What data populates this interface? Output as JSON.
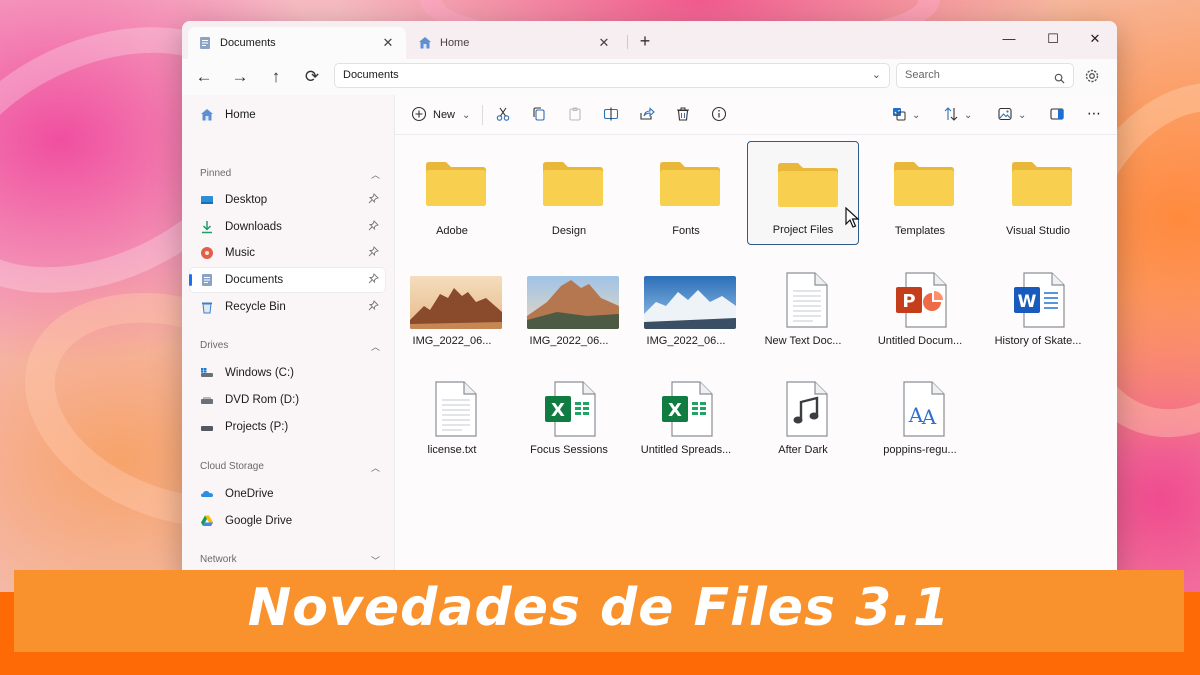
{
  "tabs": [
    {
      "label": "Documents",
      "icon": "documents-icon",
      "active": true
    },
    {
      "label": "Home",
      "icon": "home-icon",
      "active": false
    }
  ],
  "address": {
    "path": "Documents",
    "search_placeholder": "Search"
  },
  "sidebar": {
    "home": "Home",
    "sections": {
      "pinned": "Pinned",
      "drives": "Drives",
      "cloud": "Cloud Storage",
      "network": "Network"
    },
    "pinned": [
      {
        "label": "Desktop",
        "icon": "desktop-icon"
      },
      {
        "label": "Downloads",
        "icon": "download-icon"
      },
      {
        "label": "Music",
        "icon": "music-icon"
      },
      {
        "label": "Documents",
        "icon": "documents-icon",
        "selected": true
      },
      {
        "label": "Recycle Bin",
        "icon": "recycle-bin-icon"
      }
    ],
    "drives": [
      {
        "label": "Windows (C:)",
        "icon": "drive-icon"
      },
      {
        "label": "DVD Rom (D:)",
        "icon": "dvd-drive-icon"
      },
      {
        "label": "Projects (P:)",
        "icon": "drive-icon"
      }
    ],
    "cloud": [
      {
        "label": "OneDrive",
        "icon": "onedrive-icon"
      },
      {
        "label": "Google Drive",
        "icon": "google-drive-icon"
      }
    ]
  },
  "toolbar": {
    "new_label": "New"
  },
  "files": [
    {
      "name": "Adobe",
      "kind": "folder"
    },
    {
      "name": "Design",
      "kind": "folder"
    },
    {
      "name": "Fonts",
      "kind": "folder"
    },
    {
      "name": "Project Files",
      "kind": "folder",
      "selected": true
    },
    {
      "name": "Templates",
      "kind": "folder"
    },
    {
      "name": "Visual Studio",
      "kind": "folder"
    },
    {
      "name": "IMG_2022_06...",
      "kind": "image-desert"
    },
    {
      "name": "IMG_2022_06...",
      "kind": "image-mountain"
    },
    {
      "name": "IMG_2022_06...",
      "kind": "image-snow"
    },
    {
      "name": "New Text Doc...",
      "kind": "text"
    },
    {
      "name": "Untitled Docum...",
      "kind": "powerpoint"
    },
    {
      "name": "History of Skate...",
      "kind": "word"
    },
    {
      "name": "license.txt",
      "kind": "text"
    },
    {
      "name": "Focus Sessions",
      "kind": "excel"
    },
    {
      "name": "Untitled Spreads...",
      "kind": "excel"
    },
    {
      "name": "After Dark",
      "kind": "audio"
    },
    {
      "name": "poppins-regu...",
      "kind": "font"
    }
  ],
  "banner": {
    "title": "Novedades de Files 3.1"
  },
  "colors": {
    "accent": "#1a73e8",
    "banner": "#f9922c",
    "banner_edge": "#fd6a06",
    "folder": "#f8cf4f"
  }
}
